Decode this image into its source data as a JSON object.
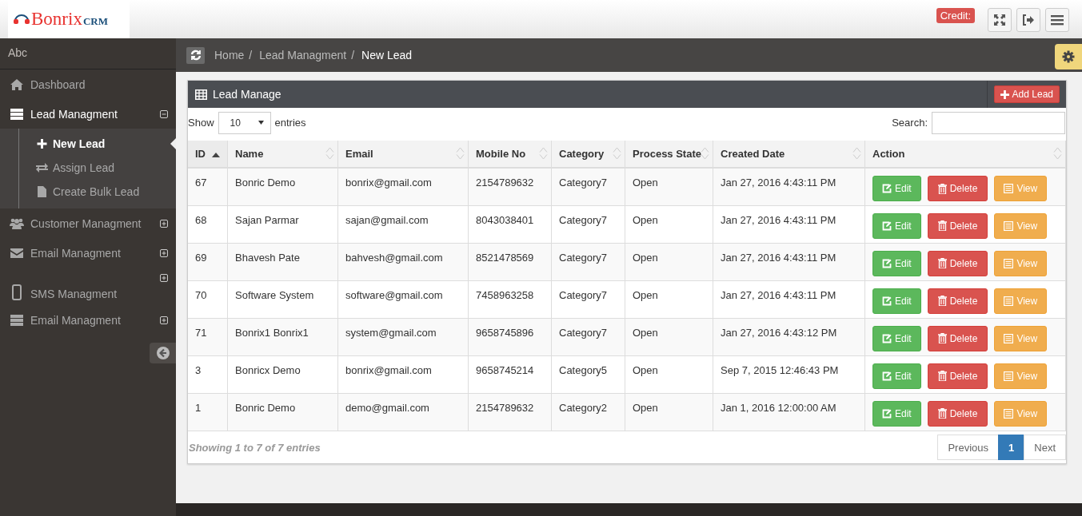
{
  "header": {
    "logo": {
      "name": "Bonrix",
      "suffix": "CRM"
    },
    "credit_badge": "Credit:"
  },
  "sidebar": {
    "user": "Abc",
    "items": [
      {
        "label": "Dashboard",
        "kind": "link",
        "selected": false
      },
      {
        "label": "Lead Managment",
        "kind": "group",
        "selected": true,
        "expanded": true,
        "children": [
          {
            "label": "New Lead",
            "selected": true
          },
          {
            "label": "Assign Lead",
            "selected": false
          },
          {
            "label": "Create Bulk Lead",
            "selected": false
          }
        ]
      },
      {
        "label": "Customer Managment",
        "kind": "group",
        "selected": false,
        "expanded": false
      },
      {
        "label": "Email Managment",
        "kind": "group",
        "selected": false,
        "expanded": false
      },
      {
        "label": "SMS Managment",
        "kind": "group",
        "selected": false,
        "expanded": false
      },
      {
        "label": "Email Managment",
        "kind": "group",
        "selected": false,
        "expanded": false
      }
    ]
  },
  "breadcrumb": [
    {
      "label": "Home",
      "separator": "/"
    },
    {
      "label": "Lead Managment",
      "separator": "/"
    },
    {
      "label": "New Lead"
    }
  ],
  "panel": {
    "title": "Lead Manage",
    "add_button": "Add Lead",
    "show_label": "Show",
    "page_size": "10",
    "entries_label": "entries",
    "search_label": "Search:",
    "table": {
      "columns": [
        {
          "label": "ID",
          "sorted": true
        },
        {
          "label": "Name",
          "sorted": false
        },
        {
          "label": "Email",
          "sorted": false
        },
        {
          "label": "Mobile No",
          "sorted": false
        },
        {
          "label": "Category",
          "sorted": false
        },
        {
          "label": "Process State",
          "sorted": false
        },
        {
          "label": "Created Date",
          "sorted": false
        },
        {
          "label": "Action",
          "sorted": false
        }
      ],
      "rows": [
        {
          "cells": [
            "67",
            "Bonric Demo",
            "bonrix@gmail.com",
            "2154789632",
            "Category7",
            "Open",
            "Jan 27, 2016 4:43:11 PM"
          ],
          "actions": [
            {
              "label": "Edit",
              "kind": "edit"
            },
            {
              "label": "Delete",
              "kind": "delete"
            },
            {
              "label": "View",
              "kind": "view"
            }
          ]
        },
        {
          "cells": [
            "68",
            "Sajan Parmar",
            "sajan@gmail.com",
            "8043038401",
            "Category7",
            "Open",
            "Jan 27, 2016 4:43:11 PM"
          ],
          "actions": [
            {
              "label": "Edit",
              "kind": "edit"
            },
            {
              "label": "Delete",
              "kind": "delete"
            },
            {
              "label": "View",
              "kind": "view"
            }
          ]
        },
        {
          "cells": [
            "69",
            "Bhavesh Pate",
            "bahvesh@gmail.com",
            "8521478569",
            "Category7",
            "Open",
            "Jan 27, 2016 4:43:11 PM"
          ],
          "actions": [
            {
              "label": "Edit",
              "kind": "edit"
            },
            {
              "label": "Delete",
              "kind": "delete"
            },
            {
              "label": "View",
              "kind": "view"
            }
          ]
        },
        {
          "cells": [
            "70",
            "Software System",
            "software@gmail.com",
            "7458963258",
            "Category7",
            "Open",
            "Jan 27, 2016 4:43:11 PM"
          ],
          "actions": [
            {
              "label": "Edit",
              "kind": "edit"
            },
            {
              "label": "Delete",
              "kind": "delete"
            },
            {
              "label": "View",
              "kind": "view"
            }
          ]
        },
        {
          "cells": [
            "71",
            "Bonrix1 Bonrix1",
            "system@gmail.com",
            "9658745896",
            "Category7",
            "Open",
            "Jan 27, 2016 4:43:12 PM"
          ],
          "actions": [
            {
              "label": "Edit",
              "kind": "edit"
            },
            {
              "label": "Delete",
              "kind": "delete"
            },
            {
              "label": "View",
              "kind": "view"
            }
          ]
        },
        {
          "cells": [
            "3",
            "Bonricx Demo",
            "bonrix@gmail.com",
            "9658745214",
            "Category5",
            "Open",
            "Sep 7, 2015 12:46:43 PM"
          ],
          "actions": [
            {
              "label": "Edit",
              "kind": "edit"
            },
            {
              "label": "Delete",
              "kind": "delete"
            },
            {
              "label": "View",
              "kind": "view"
            }
          ]
        },
        {
          "cells": [
            "1",
            "Bonric Demo",
            "demo@gmail.com",
            "2154789632",
            "Category2",
            "Open",
            "Jan 1, 2016 12:00:00 AM"
          ],
          "actions": [
            {
              "label": "Edit",
              "kind": "edit"
            },
            {
              "label": "Delete",
              "kind": "delete"
            },
            {
              "label": "View",
              "kind": "view"
            }
          ]
        }
      ]
    },
    "info": "Showing 1 to 7 of 7 entries",
    "pagination": [
      {
        "label": "Previous",
        "selected": false
      },
      {
        "label": "1",
        "selected": true
      },
      {
        "label": "Next",
        "selected": false
      }
    ]
  }
}
